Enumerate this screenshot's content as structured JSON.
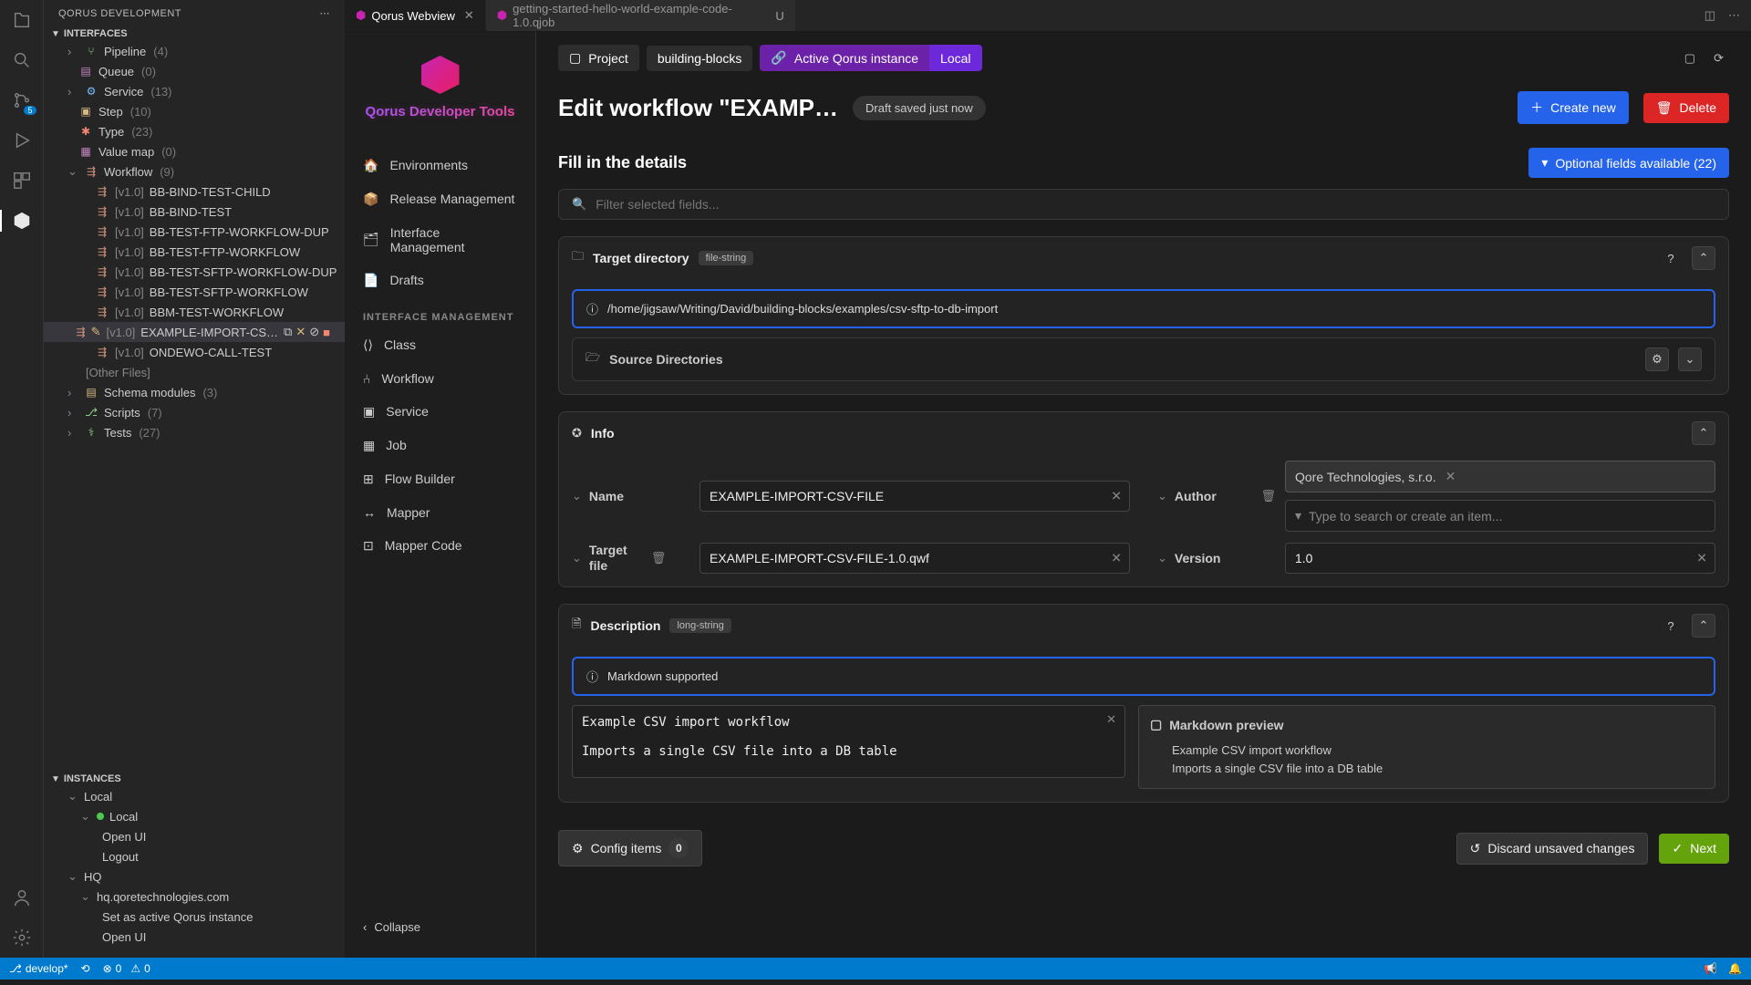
{
  "sideHeader": "QORUS DEVELOPMENT",
  "sections": {
    "interfaces": "INTERFACES",
    "instances": "INSTANCES"
  },
  "interfaceTree": {
    "pipeline": {
      "label": "Pipeline",
      "count": "(4)"
    },
    "queue": {
      "label": "Queue",
      "count": "(0)"
    },
    "service": {
      "label": "Service",
      "count": "(13)"
    },
    "step": {
      "label": "Step",
      "count": "(10)"
    },
    "type": {
      "label": "Type",
      "count": "(23)"
    },
    "valuemap": {
      "label": "Value map",
      "count": "(0)"
    },
    "workflow": {
      "label": "Workflow",
      "count": "(9)"
    },
    "wfItems": [
      {
        "ver": "[v1.0]",
        "name": "BB-BIND-TEST-CHILD"
      },
      {
        "ver": "[v1.0]",
        "name": "BB-BIND-TEST"
      },
      {
        "ver": "[v1.0]",
        "name": "BB-TEST-FTP-WORKFLOW-DUP"
      },
      {
        "ver": "[v1.0]",
        "name": "BB-TEST-FTP-WORKFLOW"
      },
      {
        "ver": "[v1.0]",
        "name": "BB-TEST-SFTP-WORKFLOW-DUP"
      },
      {
        "ver": "[v1.0]",
        "name": "BB-TEST-SFTP-WORKFLOW"
      },
      {
        "ver": "[v1.0]",
        "name": "BBM-TEST-WORKFLOW"
      },
      {
        "ver": "[v1.0]",
        "name": "EXAMPLE-IMPORT-CS…",
        "dirty": true
      },
      {
        "ver": "[v1.0]",
        "name": "ONDEWO-CALL-TEST"
      }
    ],
    "otherFiles": "[Other Files]",
    "schemaModules": {
      "label": "Schema modules",
      "count": "(3)"
    },
    "scripts": {
      "label": "Scripts",
      "count": "(7)"
    },
    "tests": {
      "label": "Tests",
      "count": "(27)"
    }
  },
  "instances": {
    "local": "Local",
    "localChild": "Local",
    "openUI": "Open UI",
    "logout": "Logout",
    "hq": "HQ",
    "hqUrl": "hq.qoretechnologies.com",
    "setActive": "Set as active Qorus instance",
    "openUI2": "Open UI"
  },
  "tabs": [
    {
      "label": "Qorus Webview",
      "active": true,
      "close": true
    },
    {
      "label": "getting-started-hello-world-example-code-1.0.qjob",
      "active": false,
      "modified": "U"
    }
  ],
  "qorusNav": {
    "title": "Qorus Developer Tools",
    "items": [
      "Environments",
      "Release Management",
      "Interface Management",
      "Drafts"
    ],
    "section": "INTERFACE MANAGEMENT",
    "mgmt": [
      "Class",
      "Workflow",
      "Service",
      "Job",
      "Flow Builder",
      "Mapper",
      "Mapper Code"
    ],
    "collapse": "Collapse"
  },
  "topbar": {
    "project": "Project",
    "building": "building-blocks",
    "active": "Active Qorus instance",
    "local": "Local"
  },
  "page": {
    "title": "Edit workflow \"EXAMP…",
    "draft": "Draft saved just now",
    "createNew": "Create new",
    "delete": "Delete",
    "fillDetails": "Fill in the details",
    "optional": "Optional fields available (22)",
    "filterPlaceholder": "Filter selected fields..."
  },
  "targetDir": {
    "label": "Target directory",
    "tag": "file-string",
    "value": "/home/jigsaw/Writing/David/building-blocks/examples/csv-sftp-to-db-import",
    "source": "Source Directories"
  },
  "info": {
    "label": "Info",
    "name": {
      "label": "Name",
      "value": "EXAMPLE-IMPORT-CSV-FILE"
    },
    "author": {
      "label": "Author",
      "value": "Qore Technologies, s.r.o.",
      "placeholder": "Type to search or create an item..."
    },
    "targetFile": {
      "label": "Target file",
      "value": "EXAMPLE-IMPORT-CSV-FILE-1.0.qwf"
    },
    "version": {
      "label": "Version",
      "value": "1.0"
    }
  },
  "desc": {
    "label": "Description",
    "tag": "long-string",
    "markdown": "Markdown supported",
    "text": "Example CSV import workflow\n\nImports a single CSV file into a DB table",
    "previewTitle": "Markdown preview",
    "previewLine1": "Example CSV import workflow",
    "previewLine2": "Imports a single CSV file into a DB table"
  },
  "config": {
    "label": "Config items",
    "count": "0"
  },
  "footer": {
    "discard": "Discard unsaved changes",
    "next": "Next"
  },
  "statusBar": {
    "branch": "develop*",
    "errors": "0",
    "warnings": "0",
    "sourceBadge": "5"
  }
}
